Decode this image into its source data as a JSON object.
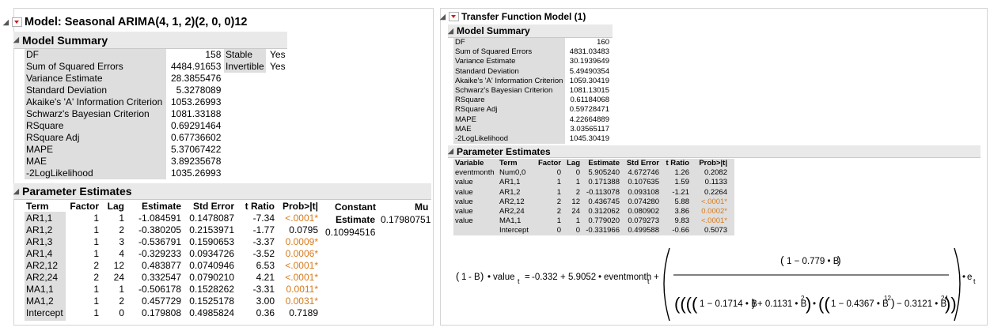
{
  "left": {
    "title": "Model: Seasonal ARIMA(4, 1, 2)(2, 0, 0)12",
    "summary_title": "Model Summary",
    "summary": [
      {
        "label": "DF",
        "value": "158"
      },
      {
        "label": "Sum of Squared Errors",
        "value": "4484.91653"
      },
      {
        "label": "Variance Estimate",
        "value": "28.3855476"
      },
      {
        "label": "Standard Deviation",
        "value": "5.3278089"
      },
      {
        "label": "Akaike's 'A' Information Criterion",
        "value": "1053.26993"
      },
      {
        "label": "Schwarz's Bayesian Criterion",
        "value": "1081.33188"
      },
      {
        "label": "RSquare",
        "value": "0.69291464"
      },
      {
        "label": "RSquare Adj",
        "value": "0.67736602"
      },
      {
        "label": "MAPE",
        "value": "5.37067422"
      },
      {
        "label": "MAE",
        "value": "3.89235678"
      },
      {
        "label": "-2LogLikelihood",
        "value": "1035.26993"
      }
    ],
    "side": [
      {
        "label": "Stable",
        "value": "Yes"
      },
      {
        "label": "Invertible",
        "value": "Yes"
      }
    ],
    "param_title": "Parameter Estimates",
    "param_headers": [
      "Term",
      "Factor",
      "Lag",
      "Estimate",
      "Std Error",
      "t Ratio",
      "Prob>|t|"
    ],
    "params": [
      {
        "term": "AR1,1",
        "factor": "1",
        "lag": "1",
        "estimate": "-1.084591",
        "stderr": "0.1478087",
        "t": "-7.34",
        "p": "<.0001*",
        "sig": true
      },
      {
        "term": "AR1,2",
        "factor": "1",
        "lag": "2",
        "estimate": "-0.380205",
        "stderr": "0.2153971",
        "t": "-1.77",
        "p": "0.0795",
        "sig": false
      },
      {
        "term": "AR1,3",
        "factor": "1",
        "lag": "3",
        "estimate": "-0.536791",
        "stderr": "0.1590653",
        "t": "-3.37",
        "p": "0.0009*",
        "sig": true
      },
      {
        "term": "AR1,4",
        "factor": "1",
        "lag": "4",
        "estimate": "-0.329233",
        "stderr": "0.0934726",
        "t": "-3.52",
        "p": "0.0006*",
        "sig": true
      },
      {
        "term": "AR2,12",
        "factor": "2",
        "lag": "12",
        "estimate": "0.483877",
        "stderr": "0.0740946",
        "t": "6.53",
        "p": "<.0001*",
        "sig": true
      },
      {
        "term": "AR2,24",
        "factor": "2",
        "lag": "24",
        "estimate": "0.332547",
        "stderr": "0.0790210",
        "t": "4.21",
        "p": "<.0001*",
        "sig": true
      },
      {
        "term": "MA1,1",
        "factor": "1",
        "lag": "1",
        "estimate": "-0.506178",
        "stderr": "0.1528262",
        "t": "-3.31",
        "p": "0.0011*",
        "sig": true
      },
      {
        "term": "MA1,2",
        "factor": "1",
        "lag": "2",
        "estimate": "0.457729",
        "stderr": "0.1525178",
        "t": "3.00",
        "p": "0.0031*",
        "sig": true
      },
      {
        "term": "Intercept",
        "factor": "1",
        "lag": "0",
        "estimate": "0.179808",
        "stderr": "0.4985824",
        "t": "0.36",
        "p": "0.7189",
        "sig": false
      }
    ],
    "constant_header": "Constant",
    "constant_sub": "Estimate",
    "constant_value": "0.10994516",
    "mu_header": "Mu",
    "mu_value": "0.17980751"
  },
  "right": {
    "title": "Transfer Function Model (1)",
    "summary_title": "Model Summary",
    "summary": [
      {
        "label": "DF",
        "value": "160"
      },
      {
        "label": "Sum of Squared Errors",
        "value": "4831.03483"
      },
      {
        "label": "Variance Estimate",
        "value": "30.1939649"
      },
      {
        "label": "Standard Deviation",
        "value": "5.49490354"
      },
      {
        "label": "Akaike's 'A' Information Criterion",
        "value": "1059.30419"
      },
      {
        "label": "Schwarz's Bayesian Criterion",
        "value": "1081.13015"
      },
      {
        "label": "RSquare",
        "value": "0.61184068"
      },
      {
        "label": "RSquare Adj",
        "value": "0.59728471"
      },
      {
        "label": "MAPE",
        "value": "4.22664889"
      },
      {
        "label": "MAE",
        "value": "3.03565117"
      },
      {
        "label": "-2LogLikelihood",
        "value": "1045.30419"
      }
    ],
    "param_title": "Parameter Estimates",
    "param_headers": [
      "Variable",
      "Term",
      "Factor",
      "Lag",
      "Estimate",
      "Std Error",
      "t Ratio",
      "Prob>|t|"
    ],
    "params": [
      {
        "var": "eventmonth",
        "term": "Num0,0",
        "factor": "0",
        "lag": "0",
        "estimate": "5.905240",
        "stderr": "4.672746",
        "t": "1.26",
        "p": "0.2082",
        "sig": false
      },
      {
        "var": "value",
        "term": "AR1,1",
        "factor": "1",
        "lag": "1",
        "estimate": "0.171388",
        "stderr": "0.107635",
        "t": "1.59",
        "p": "0.1133",
        "sig": false
      },
      {
        "var": "value",
        "term": "AR1,2",
        "factor": "1",
        "lag": "2",
        "estimate": "-0.113078",
        "stderr": "0.093108",
        "t": "-1.21",
        "p": "0.2264",
        "sig": false
      },
      {
        "var": "value",
        "term": "AR2,12",
        "factor": "2",
        "lag": "12",
        "estimate": "0.436745",
        "stderr": "0.074280",
        "t": "5.88",
        "p": "<.0001*",
        "sig": true
      },
      {
        "var": "value",
        "term": "AR2,24",
        "factor": "2",
        "lag": "24",
        "estimate": "0.312062",
        "stderr": "0.080902",
        "t": "3.86",
        "p": "0.0002*",
        "sig": true
      },
      {
        "var": "value",
        "term": "MA1,1",
        "factor": "1",
        "lag": "1",
        "estimate": "0.779020",
        "stderr": "0.079273",
        "t": "9.83",
        "p": "<.0001*",
        "sig": true
      },
      {
        "var": "",
        "term": "Intercept",
        "factor": "0",
        "lag": "0",
        "estimate": "-0.331966",
        "stderr": "0.499588",
        "t": "-0.66",
        "p": "0.5073",
        "sig": false
      }
    ],
    "formula": {
      "lhs_one": "1",
      "lhs_minus": "-",
      "lhs_B": "B",
      "dot": "•",
      "lhs_var": "value",
      "sub_t": "t",
      "eq": "=",
      "const": "-0.332",
      "plus": "+",
      "coef": "5.9052",
      "input_var": "eventmonth",
      "num_text": "1 − 0.779 • B",
      "den_a1": "1 − 0.1714 • B",
      "den_a2": "+ 0.1131 • B",
      "den_sq": "2",
      "den_b1": "1 − 0.4367 • B",
      "den_b_exp": "12",
      "den_b2": "− 0.3121 • B",
      "den_b_exp2": "24",
      "err": "e"
    }
  },
  "colors": {
    "significant": "#d77a1a",
    "header_bg": "#e9e9e9",
    "label_bg": "#dedede",
    "red_button": "#d21a1a"
  }
}
